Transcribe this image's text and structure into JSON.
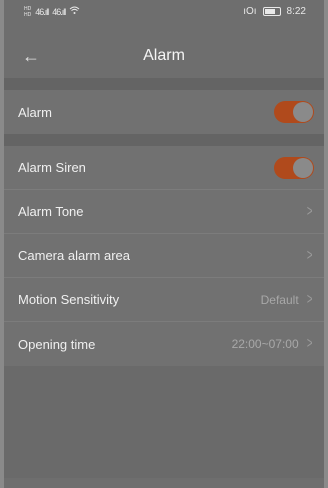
{
  "status": {
    "sim1": "HD",
    "sim2": "HD",
    "signal1": "46.ıll",
    "signal2": "46.ıll",
    "wifi": "wifi",
    "time": "8:22"
  },
  "header": {
    "title": "Alarm"
  },
  "rows": [
    {
      "label": "Alarm",
      "type": "toggle",
      "on": true
    },
    {
      "label": "Alarm Siren",
      "type": "toggle",
      "on": true
    },
    {
      "label": "Alarm Tone",
      "type": "link"
    },
    {
      "label": "Camera alarm area",
      "type": "link"
    },
    {
      "label": "Motion Sensitivity",
      "type": "link",
      "value": "Default"
    },
    {
      "label": "Opening time",
      "type": "link",
      "value": "22:00~07:00"
    }
  ],
  "colors": {
    "accent": "#b04a1c"
  }
}
